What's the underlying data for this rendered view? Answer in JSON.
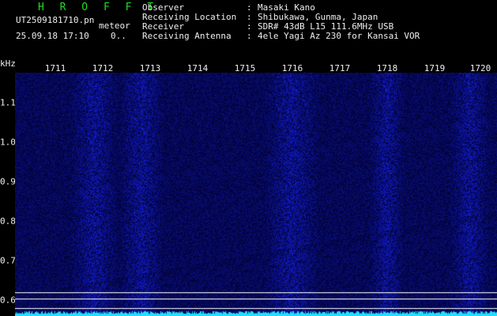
{
  "header": {
    "title": "H R O F F T",
    "filename": "UT2509181710.pn",
    "category": "meteor",
    "timestamp": "25.09.18 17:10",
    "count": "0.."
  },
  "meta": [
    {
      "key": "Observer",
      "sep": ":",
      "value": "Masaki Kano"
    },
    {
      "key": "Receiving Location",
      "sep": ":",
      "value": "Shibukawa, Gunma, Japan"
    },
    {
      "key": "Receiver",
      "sep": ":",
      "value": "SDR# 43dB L15 111.6MHz USB"
    },
    {
      "key": "Receiving Antenna",
      "sep": ":",
      "value": "4ele Yagi Az 230 for Kansai VOR"
    }
  ],
  "axis": {
    "unit": "kHz",
    "x_ticks": [
      "1711",
      "1712",
      "1713",
      "1714",
      "1715",
      "1716",
      "1717",
      "1718",
      "1719",
      "1720"
    ],
    "y_ticks": [
      "1.1",
      "1.0",
      "0.9",
      "0.8",
      "0.7",
      "0.6"
    ]
  },
  "colors": {
    "background": "#000000",
    "noise": "#0a14a0",
    "spectrum": "#22ddff",
    "header_title": "#22dd22",
    "text": "#eeeeee"
  }
}
